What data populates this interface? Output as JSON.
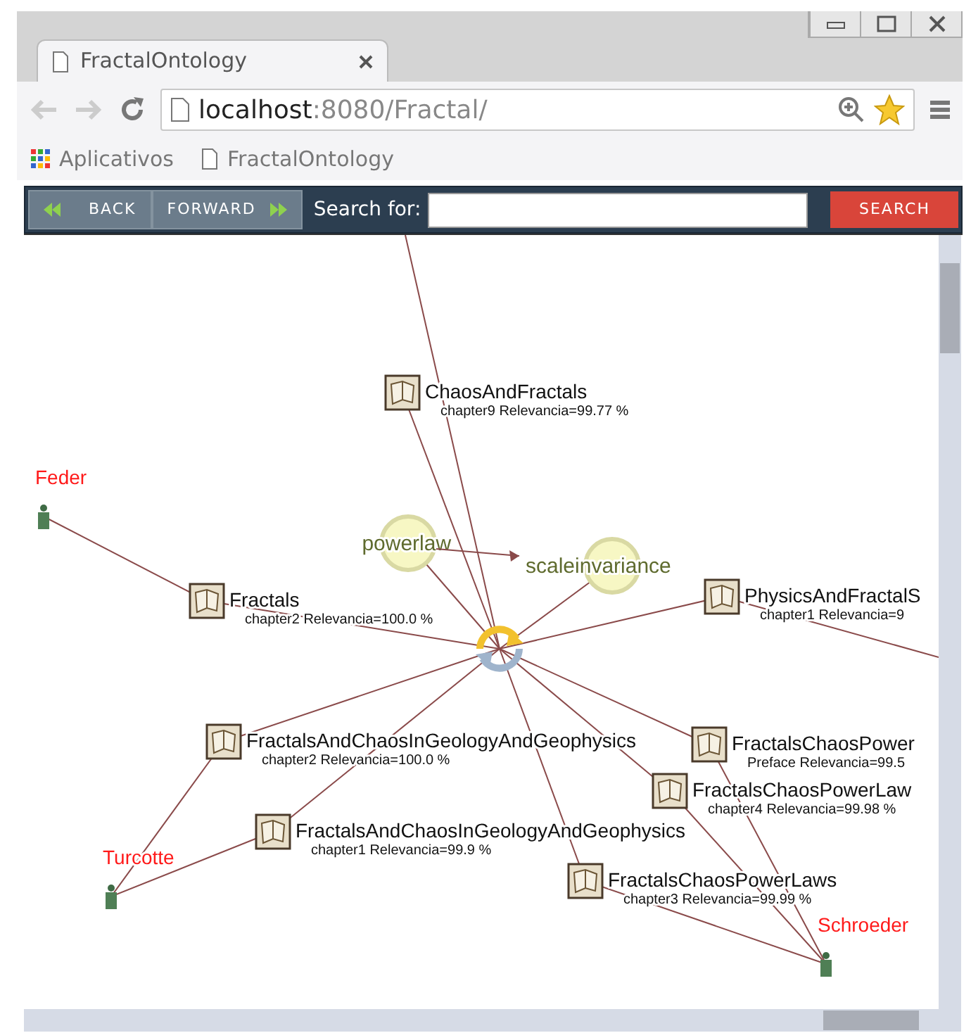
{
  "window": {
    "tab_title": "FractalOntology"
  },
  "address_bar": {
    "host": "localhost",
    "path": ":8080/Fractal/"
  },
  "bookmarks": [
    {
      "label": "Aplicativos",
      "kind": "apps"
    },
    {
      "label": "FractalOntology",
      "kind": "page"
    }
  ],
  "toolbar": {
    "back": "BACK",
    "forward": "FORWARD",
    "search_label": "Search for:",
    "search_button": "SEARCH"
  },
  "graph": {
    "nodes": [
      {
        "kind": "center"
      },
      {
        "kind": "document",
        "title": "ChaosAndFractals",
        "detail": "chapter9  Relevancia=99.77 %"
      },
      {
        "kind": "author",
        "name": "Feder"
      },
      {
        "kind": "concept",
        "name": "powerlaw"
      },
      {
        "kind": "concept",
        "name": "scaleinvariance"
      },
      {
        "kind": "document",
        "title": "Fractals",
        "detail": "chapter2  Relevancia=100.0 %"
      },
      {
        "kind": "document",
        "title": "PhysicsAndFractalS",
        "detail": "chapter1  Relevancia=9"
      },
      {
        "kind": "document",
        "title": "FractalsAndChaosInGeologyAndGeophysics",
        "detail": "chapter2  Relevancia=100.0 %"
      },
      {
        "kind": "document",
        "title": "FractalsChaosPower",
        "detail": "Preface  Relevancia=99.5"
      },
      {
        "kind": "document",
        "title": "FractalsChaosPowerLaw",
        "detail": "chapter4  Relevancia=99.98 %"
      },
      {
        "kind": "document",
        "title": "FractalsAndChaosInGeologyAndGeophysics",
        "detail": "chapter1  Relevancia=99.9 %"
      },
      {
        "kind": "author",
        "name": "Turcotte"
      },
      {
        "kind": "document",
        "title": "FractalsChaosPowerLaws",
        "detail": "chapter3  Relevancia=99.99 %"
      },
      {
        "kind": "author",
        "name": "Schroeder"
      }
    ]
  }
}
